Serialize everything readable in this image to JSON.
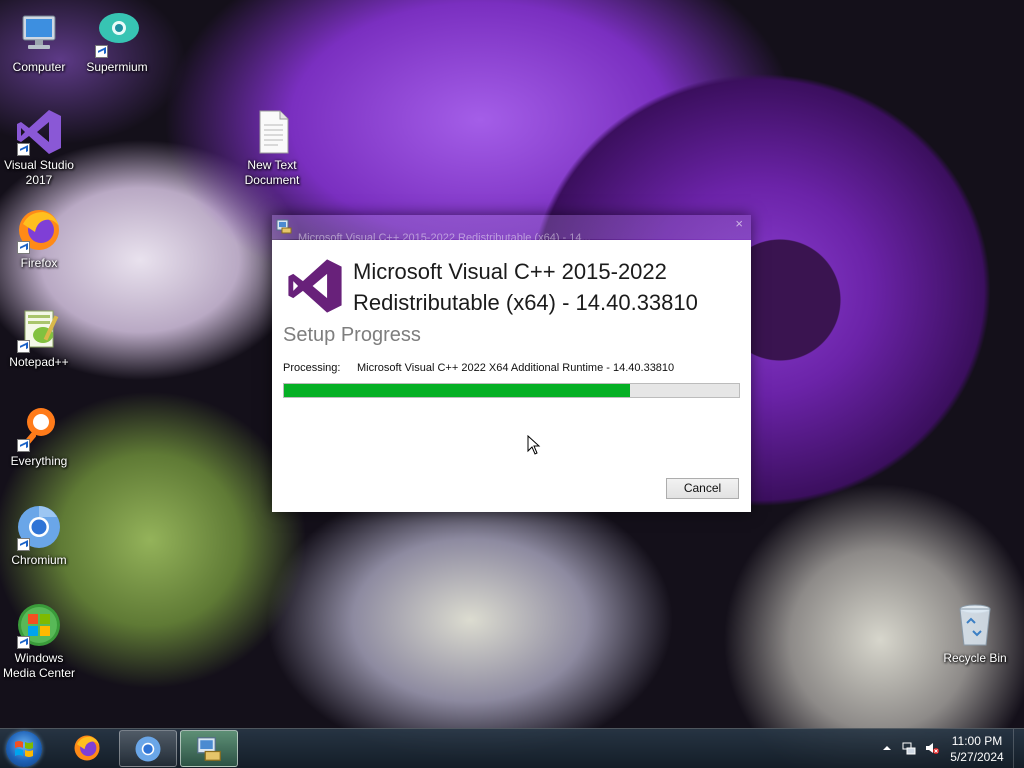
{
  "desktop": {
    "icons": [
      {
        "label": "Computer",
        "icon": "computer-icon"
      },
      {
        "label": "Supermium",
        "icon": "supermium-icon"
      },
      {
        "label": "Visual Studio 2017",
        "icon": "visual-studio-icon"
      },
      {
        "label": "New Text Document",
        "icon": "text-document-icon"
      },
      {
        "label": "Firefox",
        "icon": "firefox-icon"
      },
      {
        "label": "Notepad++",
        "icon": "notepad-plus-plus-icon"
      },
      {
        "label": "Everything",
        "icon": "everything-search-icon"
      },
      {
        "label": "Chromium",
        "icon": "chromium-icon"
      },
      {
        "label": "Windows Media Center",
        "icon": "windows-media-center-icon"
      },
      {
        "label": "Recycle Bin",
        "icon": "recycle-bin-icon"
      }
    ]
  },
  "installer": {
    "window_title": "Microsoft Visual C++ 2015-2022 Redistributable (x64) - 14...",
    "close_glyph": "×",
    "product_line1": "Microsoft Visual C++ 2015-2022",
    "product_line2": "Redistributable (x64) - 14.40.33810",
    "heading": "Setup Progress",
    "processing_label": "Processing:",
    "processing_value": "Microsoft Visual C++ 2022 X64 Additional Runtime - 14.40.33810",
    "progress_fraction": 0.76,
    "cancel_label": "Cancel",
    "accent_color": "#06b025"
  },
  "taskbar": {
    "items": [
      "start-orb",
      "firefox",
      "chromium",
      "installer"
    ],
    "clock_time": "11:00 PM",
    "clock_date": "5/27/2024"
  }
}
